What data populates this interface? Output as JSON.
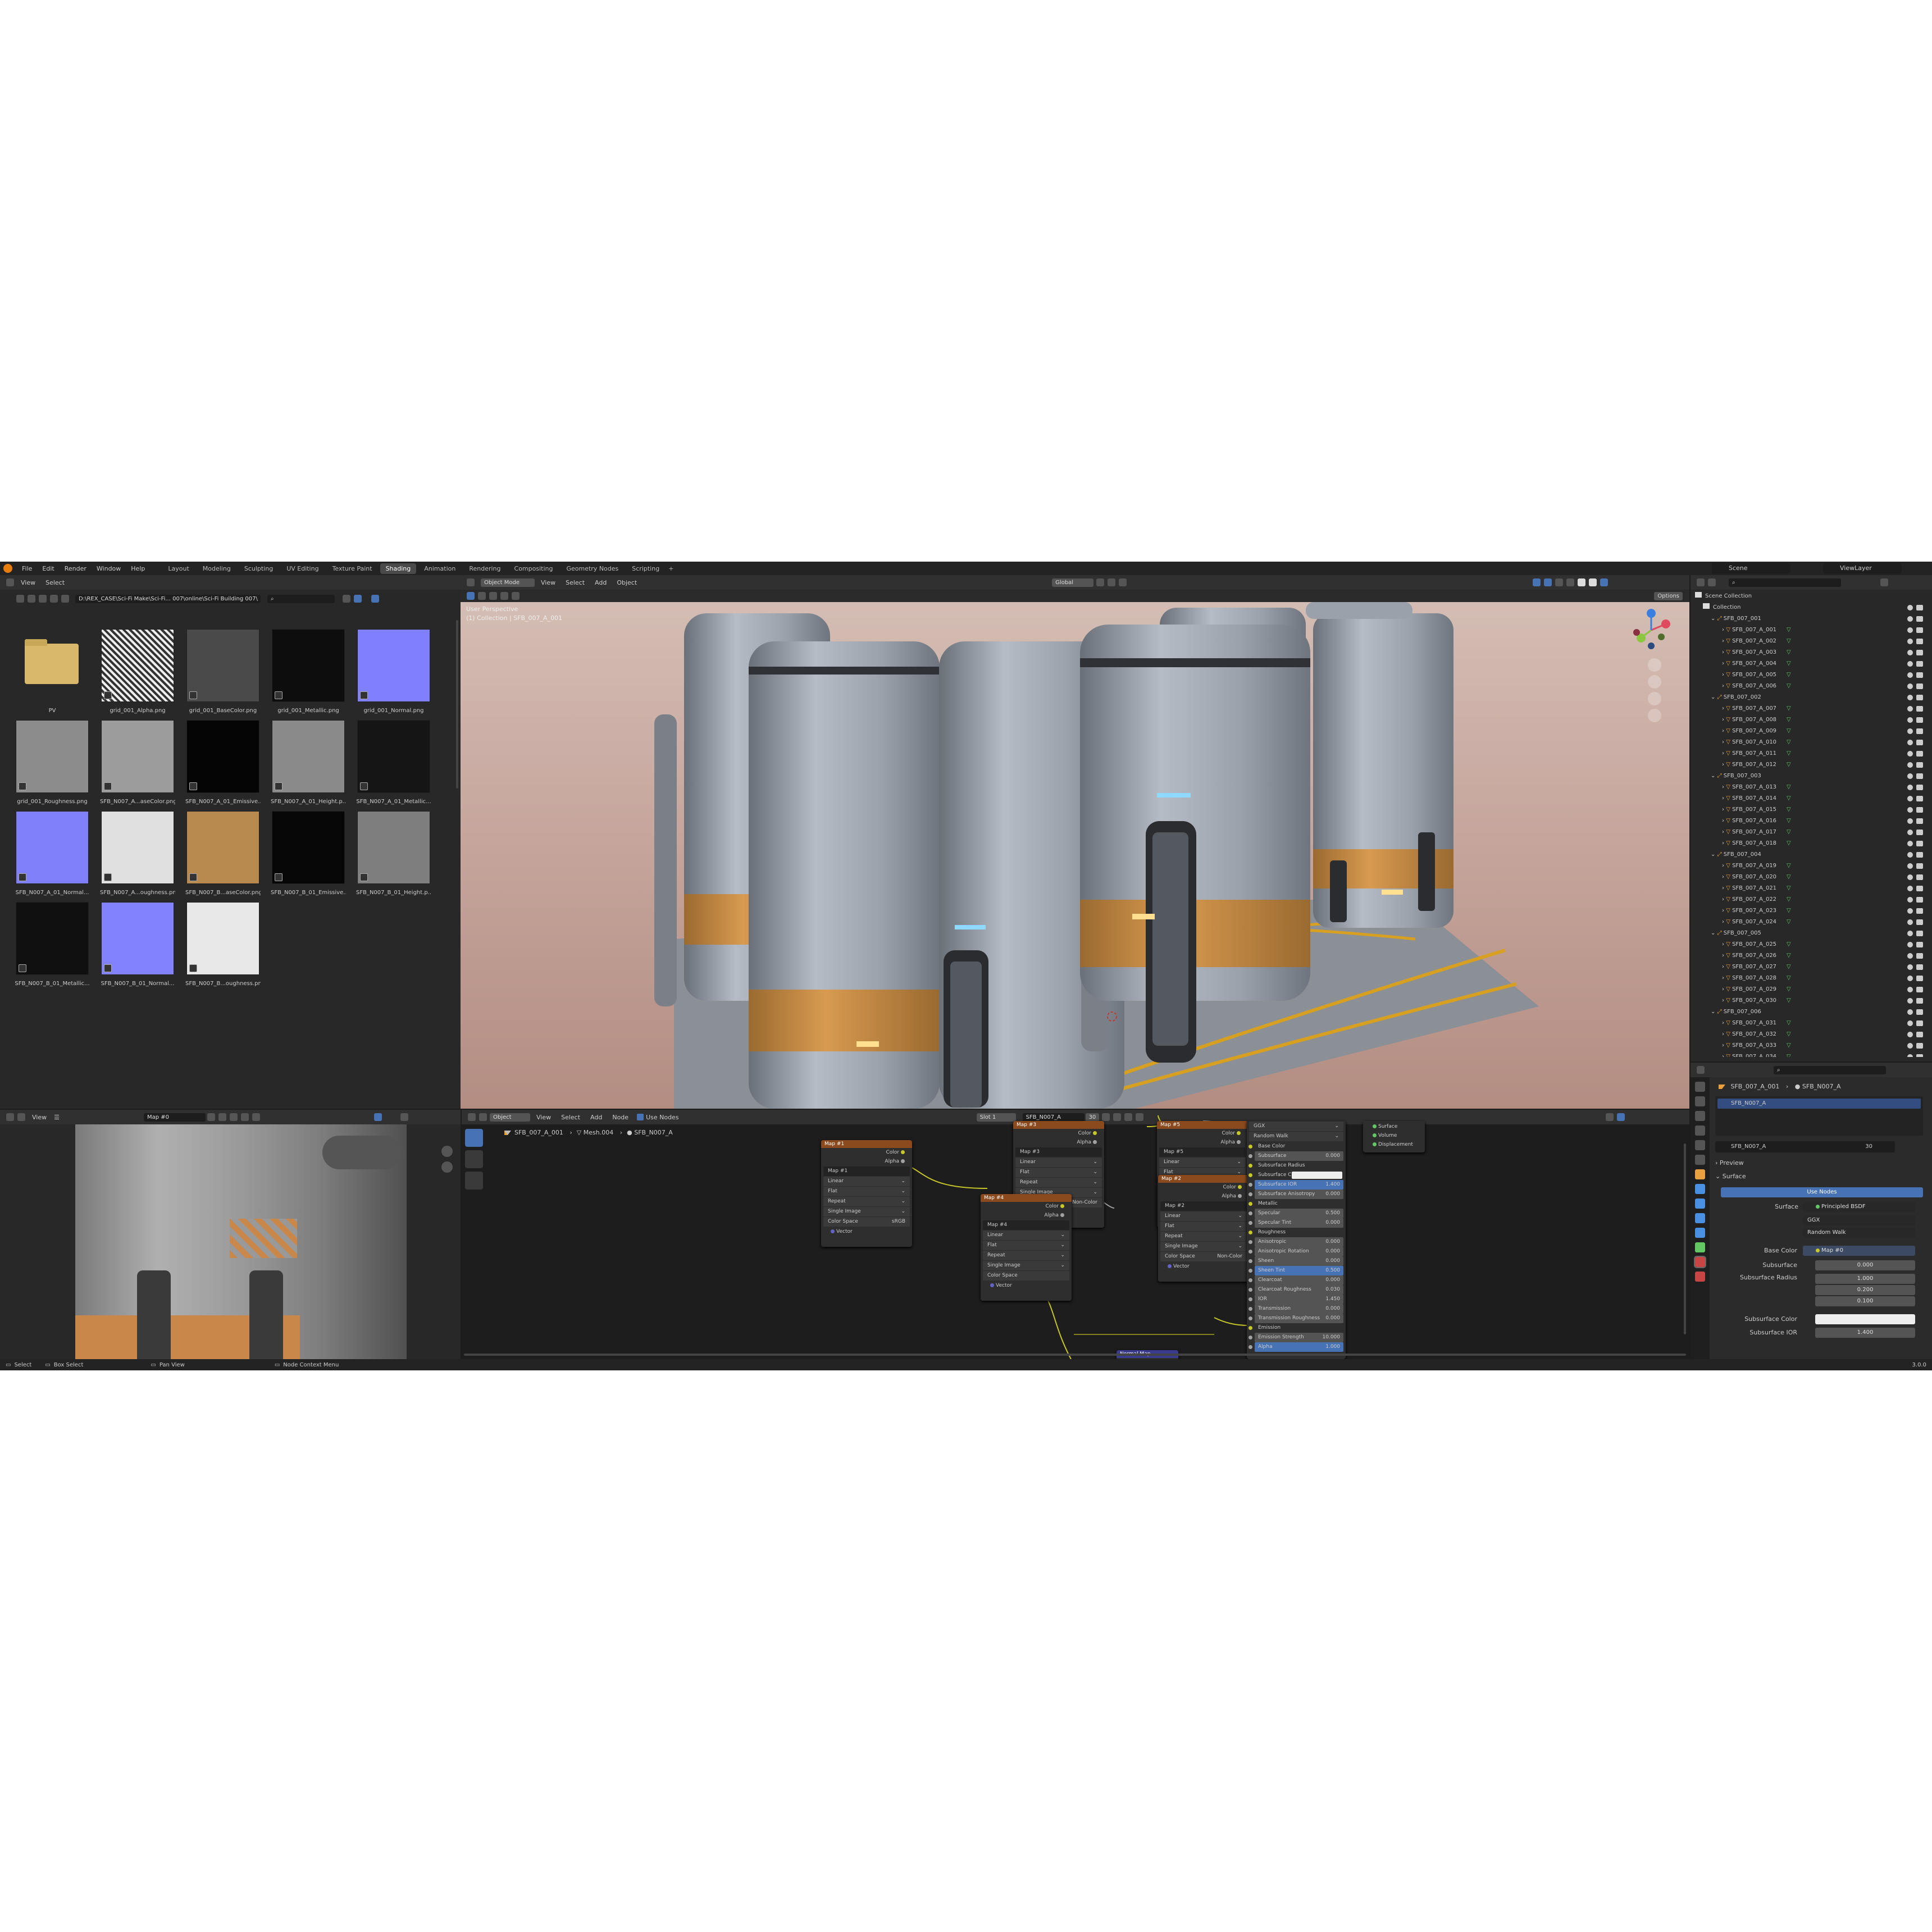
{
  "topbar": {
    "menus": [
      "File",
      "Edit",
      "Render",
      "Window",
      "Help"
    ],
    "workspaces": [
      "Layout",
      "Modeling",
      "Sculpting",
      "UV Editing",
      "Texture Paint",
      "Shading",
      "Animation",
      "Rendering",
      "Compositing",
      "Geometry Nodes",
      "Scripting"
    ],
    "active_workspace": "Shading",
    "add_tab": "+",
    "scene_label": "Scene",
    "viewlayer_label": "ViewLayer"
  },
  "file_browser": {
    "header_menus": [
      "View",
      "Select"
    ],
    "path": "D:\\REX_CASE\\Sci-Fi Make\\Sci-Fi... 007\\online\\Sci-Fi Building 007\\",
    "items": [
      {
        "label": "PV",
        "kind": "folder"
      },
      {
        "label": "grid_001_Alpha.png",
        "color": "#d8d8d8"
      },
      {
        "label": "grid_001_BaseColor.png",
        "color": "#4a4a4a"
      },
      {
        "label": "grid_001_Metallic.png",
        "color": "#0d0d0d"
      },
      {
        "label": "grid_001_Normal.png",
        "color": "#8080ff"
      },
      {
        "label": "grid_001_Roughness.png",
        "color": "#8c8c8c"
      },
      {
        "label": "SFB_N007_A...aseColor.png",
        "color": "#9c9c9c"
      },
      {
        "label": "SFB_N007_A_01_Emissive...",
        "color": "#050505"
      },
      {
        "label": "SFB_N007_A_01_Height.p...",
        "color": "#8a8a8a"
      },
      {
        "label": "SFB_N007_A_01_Metallic...",
        "color": "#151515"
      },
      {
        "label": "SFB_N007_A_01_Normal...",
        "color": "#7f7ffa"
      },
      {
        "label": "SFB_N007_A...oughness.png",
        "color": "#e0e0e0"
      },
      {
        "label": "SFB_N007_B...aseColor.png",
        "color": "#b88a50"
      },
      {
        "label": "SFB_N007_B_01_Emissive...",
        "color": "#060606"
      },
      {
        "label": "SFB_N007_B_01_Height.p...",
        "color": "#7e7e7e"
      },
      {
        "label": "SFB_N007_B_01_Metallic...",
        "color": "#101010"
      },
      {
        "label": "SFB_N007_B_01_Normal...",
        "color": "#8282ff"
      },
      {
        "label": "SFB_N007_B...oughness.png",
        "color": "#e8e8e8"
      }
    ]
  },
  "viewport": {
    "mode": "Object Mode",
    "menus": [
      "View",
      "Select",
      "Add",
      "Object"
    ],
    "transform": "Global",
    "options": "Options",
    "overlay_title": "User Perspective",
    "overlay_sub": "(1) Collection | SFB_007_A_001"
  },
  "image_editor": {
    "menus": [
      "View"
    ],
    "image_name": "Map #0"
  },
  "node_editor": {
    "object_mode": "Object",
    "menus": [
      "View",
      "Select",
      "Add",
      "Node"
    ],
    "use_nodes": "Use Nodes",
    "slot": "Slot 1",
    "material": "SFB_N007_A",
    "users": "30",
    "breadcrumb": [
      "SFB_007_A_001",
      "Mesh.004",
      "SFB_N007_A"
    ],
    "image_nodes": [
      {
        "title": "Map #1",
        "image": "Map #1",
        "interp": "Linear",
        "proj": "Flat",
        "ext": "Repeat",
        "src": "Single Image",
        "cs": "sRGB"
      },
      {
        "title": "Map #3",
        "image": "Map #3",
        "interp": "Linear",
        "proj": "Flat",
        "ext": "Repeat",
        "src": "Single Image",
        "cs": "Non-Color"
      },
      {
        "title": "Map #5",
        "image": "Map #5",
        "interp": "Linear",
        "proj": "Flat",
        "ext": "Repeat",
        "src": "Single Image",
        "cs": "sRGB"
      },
      {
        "title": "Map #2",
        "image": "Map #2",
        "interp": "Linear",
        "proj": "Flat",
        "ext": "Repeat",
        "src": "Single Image",
        "cs": "Non-Color"
      },
      {
        "title": "Map #4",
        "image": "Map #4",
        "interp": "Linear",
        "proj": "Flat",
        "ext": "Repeat",
        "src": "Single Image",
        "cs": ""
      }
    ],
    "socket_labels": {
      "color": "Color",
      "alpha": "Alpha",
      "vector": "Vector",
      "colorspace": "Color Space"
    },
    "bsdf": {
      "dist": "GGX",
      "sss_method": "Random Walk",
      "rows": [
        {
          "label": "Base Color",
          "value": ""
        },
        {
          "label": "Subsurface",
          "value": "0.000"
        },
        {
          "label": "Subsurface Radius",
          "value": ""
        },
        {
          "label": "Subsurface Co",
          "value": ""
        },
        {
          "label": "Subsurface IOR",
          "value": "1.400"
        },
        {
          "label": "Subsurface Anisotropy",
          "value": "0.000"
        },
        {
          "label": "Metallic",
          "value": ""
        },
        {
          "label": "Specular",
          "value": "0.500"
        },
        {
          "label": "Specular Tint",
          "value": "0.000"
        },
        {
          "label": "Roughness",
          "value": ""
        },
        {
          "label": "Anisotropic",
          "value": "0.000"
        },
        {
          "label": "Anisotropic Rotation",
          "value": "0.000"
        },
        {
          "label": "Sheen",
          "value": "0.000"
        },
        {
          "label": "Sheen Tint",
          "value": "0.500"
        },
        {
          "label": "Clearcoat",
          "value": "0.000"
        },
        {
          "label": "Clearcoat Roughness",
          "value": "0.030"
        },
        {
          "label": "IOR",
          "value": "1.450"
        },
        {
          "label": "Transmission",
          "value": "0.000"
        },
        {
          "label": "Transmission Roughness",
          "value": "0.000"
        },
        {
          "label": "Emission",
          "value": ""
        },
        {
          "label": "Emission Strength",
          "value": "10.000"
        },
        {
          "label": "Alpha",
          "value": "1.000"
        }
      ]
    },
    "output_node": {
      "sockets": [
        "Surface",
        "Volume",
        "Displacement"
      ]
    },
    "normal_map_title": "Normal Map"
  },
  "outliner": {
    "scene_collection": "Scene Collection",
    "collection": "Collection",
    "groups": [
      {
        "name": "SFB_007_001",
        "items": [
          "SFB_007_A_001",
          "SFB_007_A_002",
          "SFB_007_A_003",
          "SFB_007_A_004",
          "SFB_007_A_005",
          "SFB_007_A_006"
        ]
      },
      {
        "name": "SFB_007_002",
        "items": [
          "SFB_007_A_007",
          "SFB_007_A_008",
          "SFB_007_A_009",
          "SFB_007_A_010",
          "SFB_007_A_011",
          "SFB_007_A_012"
        ]
      },
      {
        "name": "SFB_007_003",
        "items": [
          "SFB_007_A_013",
          "SFB_007_A_014",
          "SFB_007_A_015",
          "SFB_007_A_016",
          "SFB_007_A_017",
          "SFB_007_A_018"
        ]
      },
      {
        "name": "SFB_007_004",
        "items": [
          "SFB_007_A_019",
          "SFB_007_A_020",
          "SFB_007_A_021",
          "SFB_007_A_022",
          "SFB_007_A_023",
          "SFB_007_A_024"
        ]
      },
      {
        "name": "SFB_007_005",
        "items": [
          "SFB_007_A_025",
          "SFB_007_A_026",
          "SFB_007_A_027",
          "SFB_007_A_028",
          "SFB_007_A_029",
          "SFB_007_A_030"
        ]
      },
      {
        "name": "SFB_007_006",
        "items": [
          "SFB_007_A_031",
          "SFB_007_A_032",
          "SFB_007_A_033",
          "SFB_007_A_034"
        ]
      }
    ]
  },
  "properties": {
    "breadcrumb": [
      "SFB_007_A_001",
      "SFB_N007_A"
    ],
    "slot_item": "SFB_N007_A",
    "material": "SFB_N007_A",
    "users": "30",
    "preview": "Preview",
    "surface_panel": "Surface",
    "use_nodes": "Use Nodes",
    "surface_label": "Surface",
    "surface_value": "Principled BSDF",
    "dist": "GGX",
    "sss": "Random Walk",
    "base_color_label": "Base Color",
    "base_color_value": "Map #0",
    "subsurface_label": "Subsurface",
    "subsurface_value": "0.000",
    "radius_label": "Subsurface Radius",
    "radius_values": [
      "1.000",
      "0.200",
      "0.100"
    ],
    "sss_color_label": "Subsurface Color",
    "sss_ior_label": "Subsurface IOR",
    "sss_ior_value": "1.400"
  },
  "statusbar": {
    "items": [
      "Select",
      "Box Select",
      "Pan View",
      "Node Context Menu"
    ],
    "version": "3.0.0"
  }
}
